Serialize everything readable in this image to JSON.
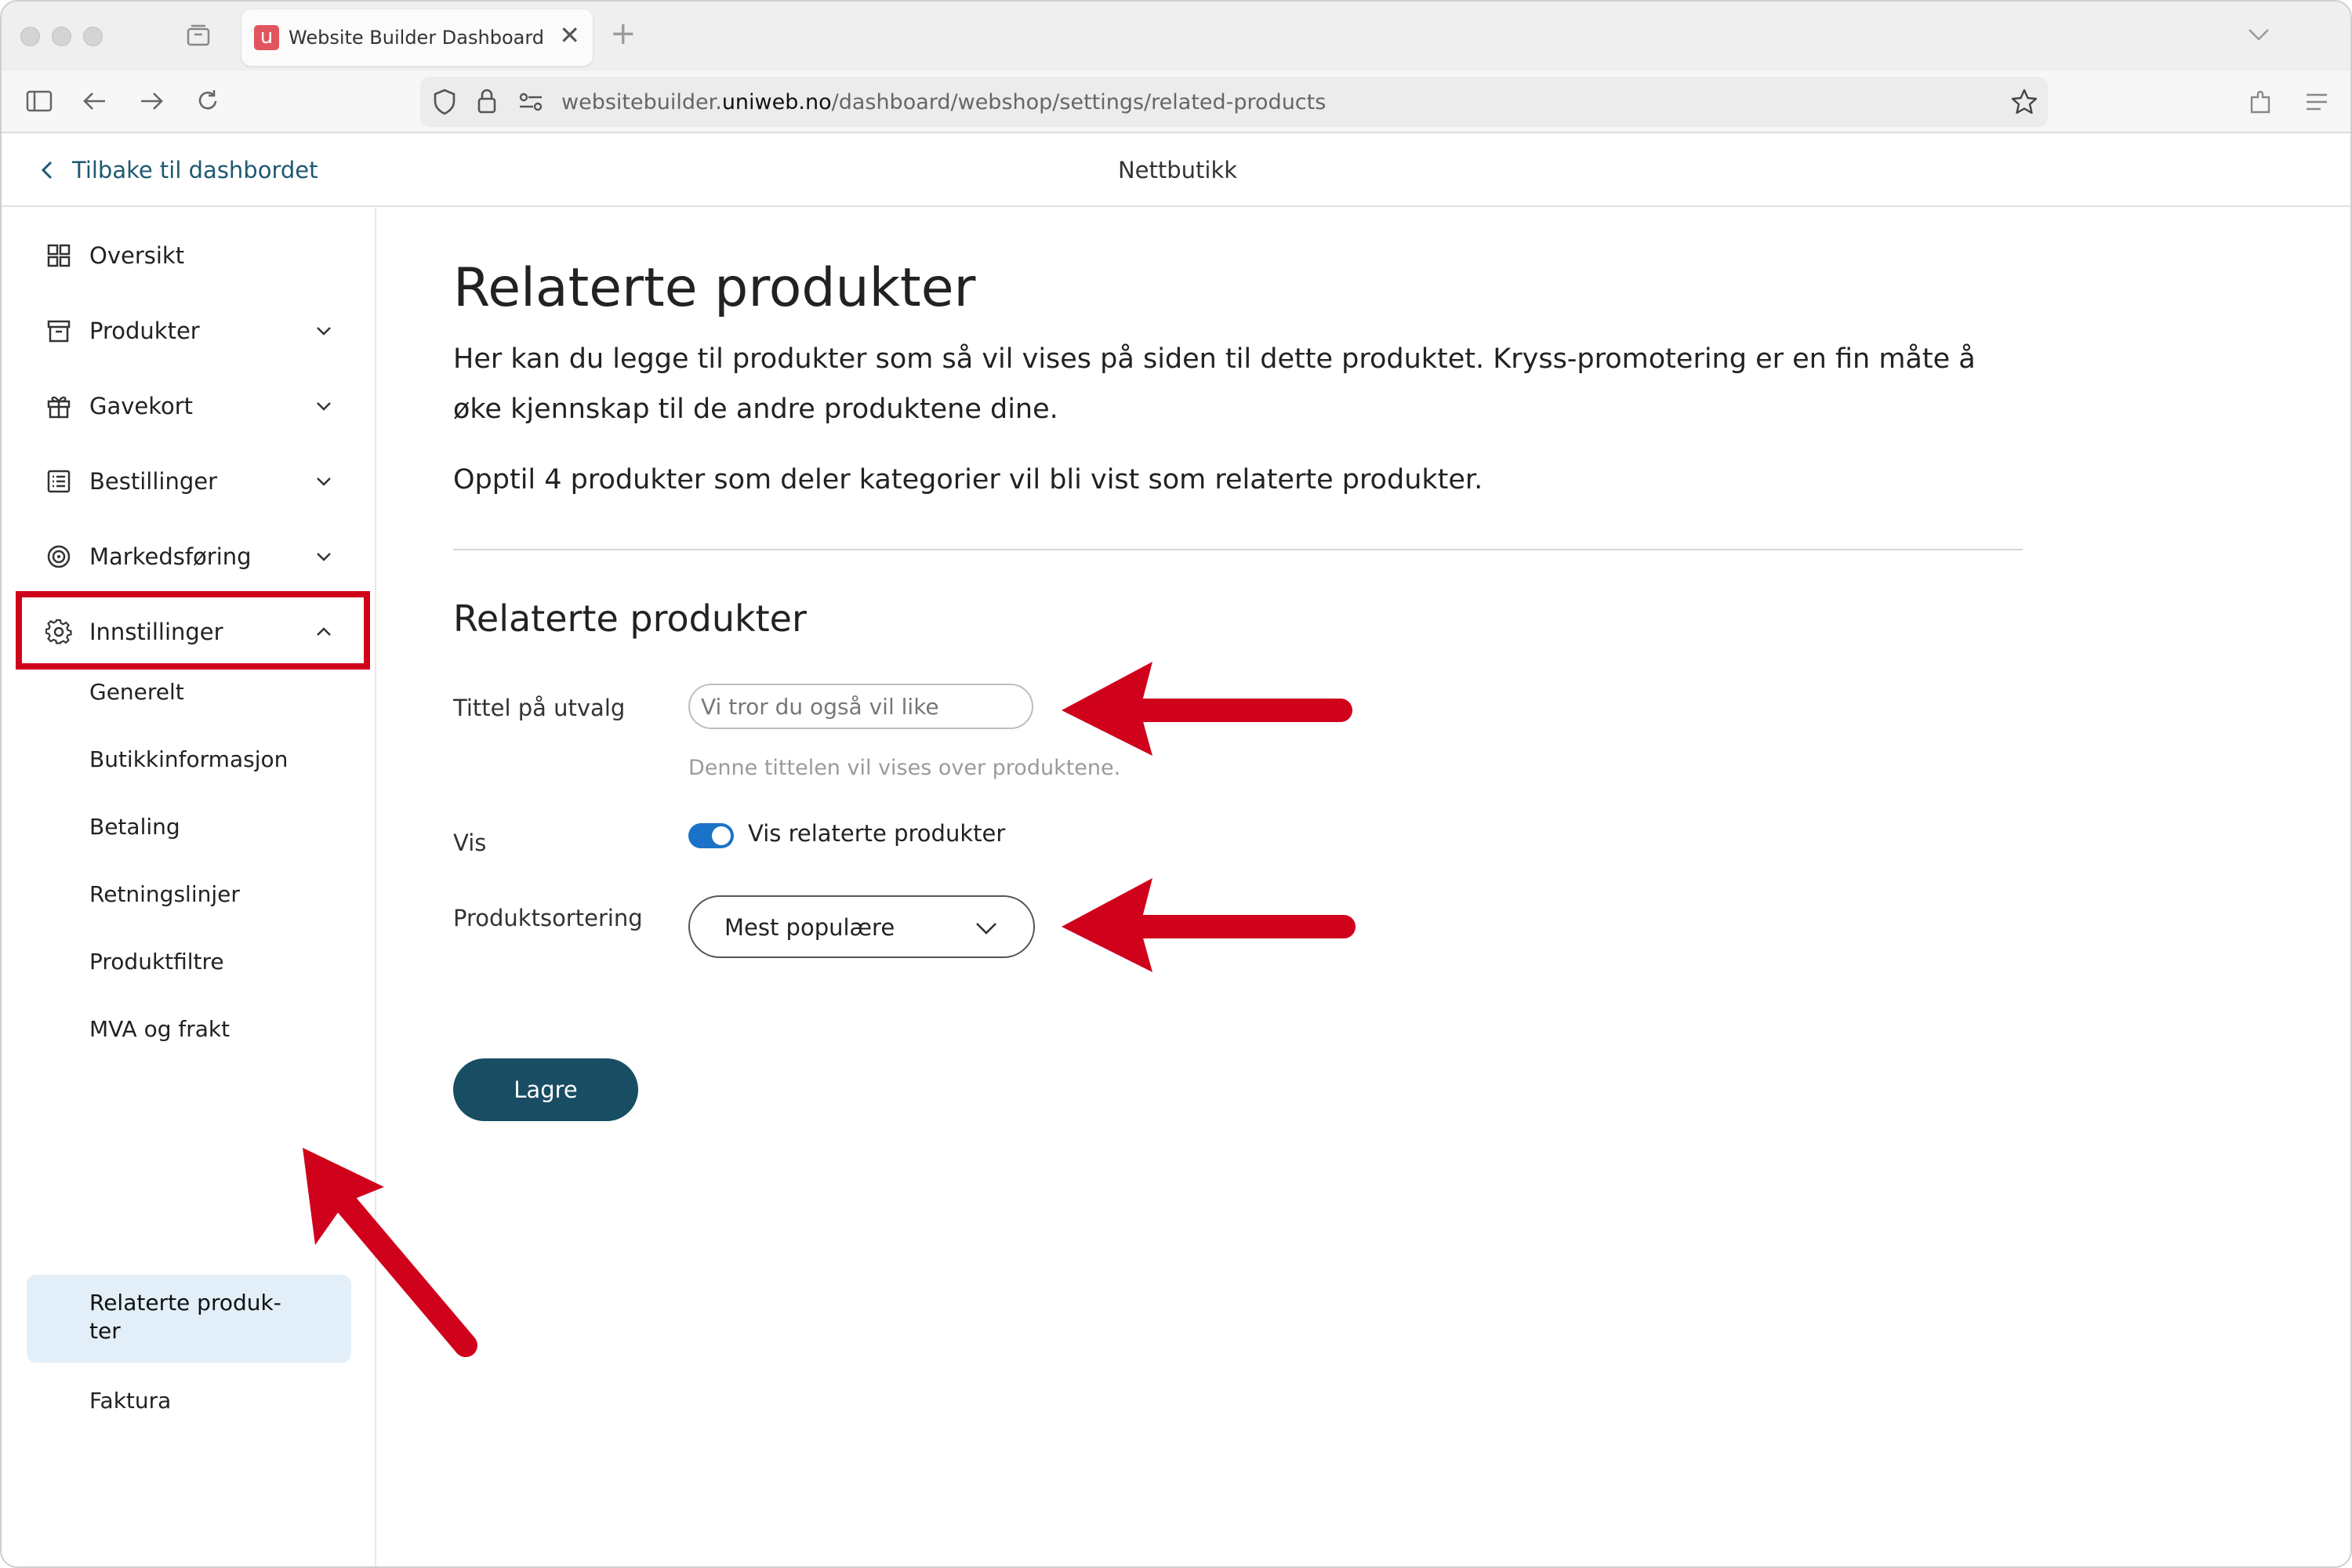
{
  "browser": {
    "tab_title": "Website Builder Dashboard",
    "tab_favicon": "u",
    "new_tab": "+",
    "url_prefix": "websitebuilder.",
    "url_domain": "uniweb.no",
    "url_path": "/dashboard/webshop/settings/related-products",
    "tab_close": "✕"
  },
  "header": {
    "back_label": "Tilbake til dashbordet",
    "title": "Nettbutikk"
  },
  "sidebar": {
    "items": [
      {
        "label": "Oversikt",
        "icon": "grid-icon"
      },
      {
        "label": "Produkter",
        "icon": "archive-box-icon"
      },
      {
        "label": "Gavekort",
        "icon": "gift-icon"
      },
      {
        "label": "Bestillinger",
        "icon": "list-icon"
      },
      {
        "label": "Markedsføring",
        "icon": "target-icon"
      },
      {
        "label": "Innstillinger",
        "icon": "gear-icon"
      }
    ],
    "sub_items": [
      "Generelt",
      "Butikkinformasjon",
      "Betaling",
      "Retningslinjer",
      "Produktfiltre",
      "MVA og frakt",
      "Faktura"
    ],
    "active_sub_line1": "Relaterte produk-",
    "active_sub_line2": "ter"
  },
  "main": {
    "title": "Relaterte produkter",
    "description": "Her kan du legge til produkter som så vil vises på siden til dette produktet. Kryss-promotering er en fin måte å øke kjennskap til de andre produktene dine.",
    "description2": "Opptil 4 produkter som deler kategorier vil bli vist som relaterte produkter.",
    "section_title": "Relaterte produkter",
    "title_field_label": "Tittel på utvalg",
    "title_field_placeholder": "Vi tror du også vil like",
    "title_field_hint": "Denne tittelen vil vises over produktene.",
    "show_label": "Vis",
    "toggle_label": "Vis relaterte produkter",
    "toggle_on": true,
    "sort_label": "Produktsortering",
    "sort_value": "Mest populære",
    "save_label": "Lagre"
  },
  "colors": {
    "annotation": "#d0021b",
    "primary_button": "#184d63",
    "link": "#1e5870",
    "toggle": "#1a73c8",
    "active_bg": "#e2eff8"
  }
}
